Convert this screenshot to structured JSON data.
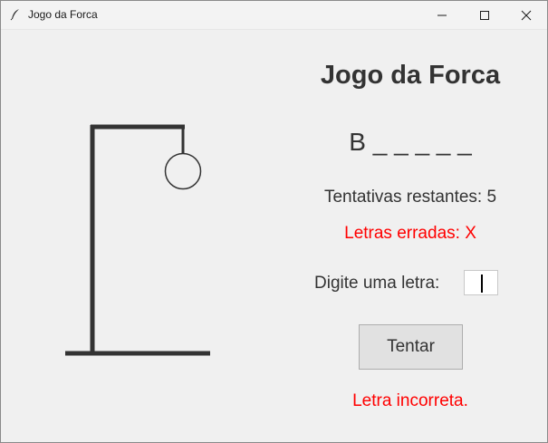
{
  "window": {
    "title": "Jogo da Forca"
  },
  "game": {
    "title": "Jogo da Forca",
    "word_display": "B _ _ _ _ _",
    "attempts_text": "Tentativas restantes: 5",
    "wrong_letters_text": "Letras erradas: X",
    "input_label": "Digite uma letra:",
    "input_value": "",
    "try_button_label": "Tentar",
    "feedback_text": "Letra incorreta."
  },
  "colors": {
    "background": "#f0f0f0",
    "text": "#333333",
    "error": "#ff0000",
    "gallows": "#333333"
  },
  "icons": {
    "app": "feather-icon",
    "minimize": "minimize-icon",
    "maximize": "maximize-icon",
    "close": "close-icon"
  }
}
